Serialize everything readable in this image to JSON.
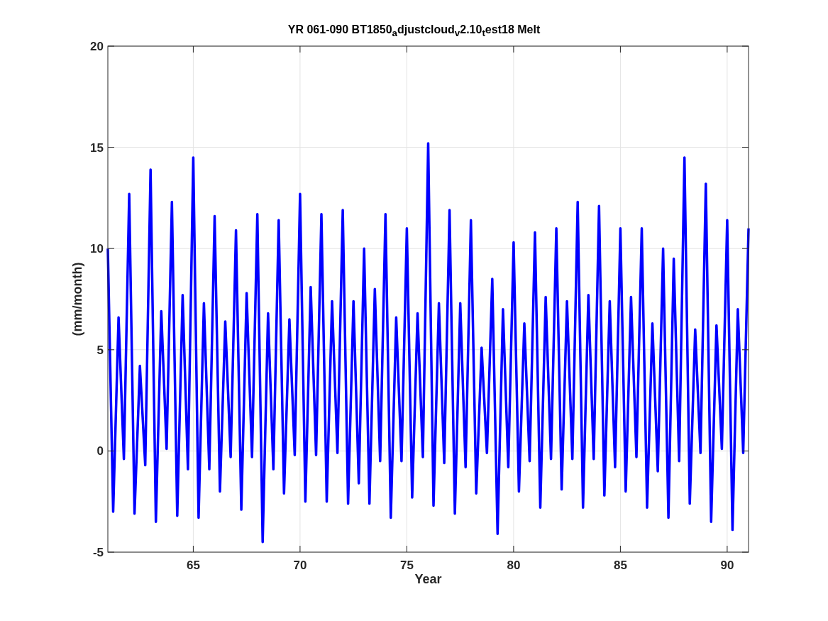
{
  "chart_data": {
    "type": "line",
    "title": "YR 061-090 BT1850$_{a}$djustcloud$_{v}$2.10$_{t}$est18 Melt",
    "xlabel": "Year",
    "ylabel": "(mm/month)",
    "xlim": [
      61,
      91
    ],
    "ylim": [
      -5,
      20
    ],
    "xticks": [
      65,
      70,
      75,
      80,
      85,
      90
    ],
    "yticks": [
      -5,
      0,
      5,
      10,
      15,
      20
    ],
    "grid": true,
    "x": [
      61,
      61.25,
      61.5,
      61.75,
      62,
      62.25,
      62.5,
      62.75,
      63,
      63.25,
      63.5,
      63.75,
      64,
      64.25,
      64.5,
      64.75,
      65,
      65.25,
      65.5,
      65.75,
      66,
      66.25,
      66.5,
      66.75,
      67,
      67.25,
      67.5,
      67.75,
      68,
      68.25,
      68.5,
      68.75,
      69,
      69.25,
      69.5,
      69.75,
      70,
      70.25,
      70.5,
      70.75,
      71,
      71.25,
      71.5,
      71.75,
      72,
      72.25,
      72.5,
      72.75,
      73,
      73.25,
      73.5,
      73.75,
      74,
      74.25,
      74.5,
      74.75,
      75,
      75.25,
      75.5,
      75.75,
      76,
      76.25,
      76.5,
      76.75,
      77,
      77.25,
      77.5,
      77.75,
      78,
      78.25,
      78.5,
      78.75,
      79,
      79.25,
      79.5,
      79.75,
      80,
      80.25,
      80.5,
      80.75,
      81,
      81.25,
      81.5,
      81.75,
      82,
      82.25,
      82.5,
      82.75,
      83,
      83.25,
      83.5,
      83.75,
      84,
      84.25,
      84.5,
      84.75,
      85,
      85.25,
      85.5,
      85.75,
      86,
      86.25,
      86.5,
      86.75,
      87,
      87.25,
      87.5,
      87.75,
      88,
      88.25,
      88.5,
      88.75,
      89,
      89.25,
      89.5,
      89.75,
      90,
      90.25,
      90.5,
      90.75,
      91
    ],
    "series": [
      {
        "color": "#0000ff",
        "values": [
          10,
          -3,
          6.6,
          -0.4,
          12.7,
          -3.1,
          4.2,
          -0.7,
          13.9,
          -3.5,
          6.9,
          0.1,
          12.3,
          -3.2,
          7.7,
          -0.9,
          14.5,
          -3.3,
          7.3,
          -0.9,
          11.6,
          -2,
          6.4,
          -0.3,
          10.9,
          -2.9,
          7.8,
          -0.3,
          11.7,
          -4.5,
          6.8,
          -0.9,
          11.4,
          -2.1,
          6.5,
          -0.2,
          12.7,
          -2.5,
          8.1,
          -0.2,
          11.7,
          -2.5,
          7.4,
          -0.1,
          11.9,
          -2.6,
          7.4,
          -1.6,
          10,
          -2.6,
          8,
          -0.5,
          11.7,
          -3.3,
          6.6,
          -0.5,
          11,
          -2.3,
          6.8,
          -0.3,
          15.2,
          -2.7,
          7.3,
          -0.6,
          11.9,
          -3.1,
          7.3,
          -0.8,
          11.4,
          -2.1,
          5.1,
          -0.1,
          8.5,
          -4.1,
          7,
          -0.8,
          10.3,
          -2,
          6.3,
          -0.5,
          10.8,
          -2.8,
          7.6,
          -0.4,
          11,
          -1.9,
          7.4,
          -0.4,
          12.3,
          -2.8,
          7.7,
          -0.4,
          12.1,
          -2.2,
          7.4,
          -0.8,
          11,
          -2,
          7.6,
          -0.3,
          11,
          -2.8,
          6.3,
          -1,
          10,
          -3.3,
          9.5,
          -0.5,
          14.5,
          -2.6,
          6,
          -0.1,
          13.2,
          -3.5,
          6.2,
          0.1,
          11.4,
          -3.9,
          7,
          -0.1,
          11
        ]
      }
    ]
  }
}
